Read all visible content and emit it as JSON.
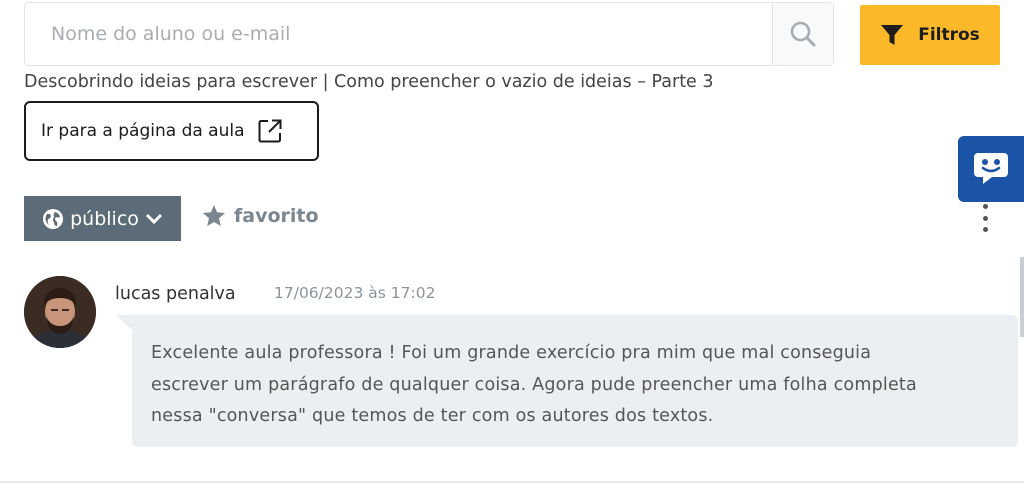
{
  "search": {
    "placeholder": "Nome do aluno ou e-mail",
    "icon": "search-icon"
  },
  "filters": {
    "label": "Filtros",
    "icon": "filter-icon",
    "color": "#fbb829"
  },
  "lesson": {
    "title": "Descobrindo ideias para escrever | Como preencher o vazio de ideias – Parte 3",
    "link_label": "Ir para a página da aula",
    "link_icon": "external-link-icon"
  },
  "chat_widget": {
    "icon": "chat-smile-icon",
    "color": "#1b53a6"
  },
  "actions": {
    "visibility_label": "público",
    "visibility_icon": "globe-icon",
    "favorite_label": "favorito",
    "favorite_icon": "star-icon",
    "more_icon": "kebab-menu-icon"
  },
  "comment": {
    "author": "lucas penalva",
    "date": "17/06/2023 às 17:02",
    "lines": [
      "Excelente aula professora ! Foi um grande exercício pra mim que mal conseguia",
      "escrever um parágrafo de qualquer coisa. Agora pude preencher uma folha completa",
      "nessa \"conversa\" que temos de ter com os autores dos textos."
    ]
  }
}
